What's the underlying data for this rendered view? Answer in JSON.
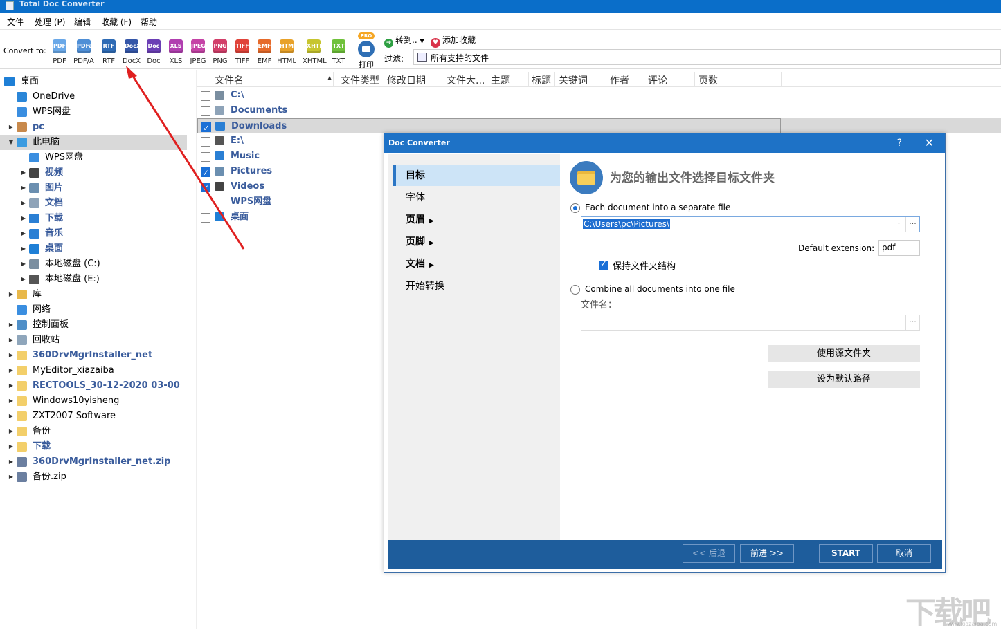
{
  "window": {
    "title": "Total Doc Converter"
  },
  "menu": [
    "文件",
    "处理 (P)",
    "编辑",
    "收藏 (F)",
    "帮助"
  ],
  "toolbar": {
    "convert_label": "Convert to:",
    "formats": [
      {
        "icon": "PDF",
        "label": "PDF",
        "color": "#6aa8e8"
      },
      {
        "icon": "PDFa",
        "label": "PDF/A",
        "color": "#4f8fd6"
      },
      {
        "icon": "RTF",
        "label": "RTF",
        "color": "#2e6bb5"
      },
      {
        "icon": "DocX",
        "label": "DocX",
        "color": "#3456a8"
      },
      {
        "icon": "Doc",
        "label": "Doc",
        "color": "#6b3fb5"
      },
      {
        "icon": "XLS",
        "label": "XLS",
        "color": "#b13fb0"
      },
      {
        "icon": "JPEG",
        "label": "JPEG",
        "color": "#c543a6"
      },
      {
        "icon": "PNG",
        "label": "PNG",
        "color": "#d23f6a"
      },
      {
        "icon": "TIFF",
        "label": "TIFF",
        "color": "#e0443a"
      },
      {
        "icon": "EMF",
        "label": "EMF",
        "color": "#e66a2a"
      },
      {
        "icon": "HTML",
        "label": "HTML",
        "color": "#e8a22a"
      },
      {
        "icon": "XHTML",
        "label": "XHTML",
        "color": "#c7c52f"
      },
      {
        "icon": "TXT",
        "label": "TXT",
        "color": "#6fc13a"
      }
    ],
    "pro_badge": "PRO",
    "print_label": "打印",
    "goto_label": "转到..",
    "fav_label": "添加收藏",
    "filter_label": "过滤:",
    "filter_value": "所有支持的文件"
  },
  "tree": [
    {
      "label": "桌面",
      "level": 0,
      "arrow": "",
      "icon": "#1e7fd6",
      "blue": false
    },
    {
      "label": "OneDrive",
      "level": 1,
      "arrow": "",
      "icon": "#2a86d8",
      "blue": false
    },
    {
      "label": "WPS网盘",
      "level": 1,
      "arrow": "",
      "icon": "#3a8ee0",
      "blue": false
    },
    {
      "label": "pc",
      "level": 1,
      "arrow": "▶",
      "icon": "#c8894b",
      "blue": true
    },
    {
      "label": "此电脑",
      "level": 1,
      "arrow": "▼",
      "icon": "#3b9be0",
      "blue": false,
      "selected": true
    },
    {
      "label": "WPS网盘",
      "level": 2,
      "arrow": "",
      "icon": "#3a8ee0",
      "blue": false
    },
    {
      "label": "视频",
      "level": 2,
      "arrow": "▶",
      "icon": "#444",
      "blue": true
    },
    {
      "label": "图片",
      "level": 2,
      "arrow": "▶",
      "icon": "#6b8fb0",
      "blue": true
    },
    {
      "label": "文档",
      "level": 2,
      "arrow": "▶",
      "icon": "#8ea3b8",
      "blue": true
    },
    {
      "label": "下载",
      "level": 2,
      "arrow": "▶",
      "icon": "#2a7fd4",
      "blue": true
    },
    {
      "label": "音乐",
      "level": 2,
      "arrow": "▶",
      "icon": "#2a7fd4",
      "blue": true
    },
    {
      "label": "桌面",
      "level": 2,
      "arrow": "▶",
      "icon": "#1e7fd6",
      "blue": true
    },
    {
      "label": "本地磁盘 (C:)",
      "level": 2,
      "arrow": "▶",
      "icon": "#7a8ea0",
      "blue": false
    },
    {
      "label": "本地磁盘 (E:)",
      "level": 2,
      "arrow": "▶",
      "icon": "#555",
      "blue": false
    },
    {
      "label": "库",
      "level": 1,
      "arrow": "▶",
      "icon": "#e8b84a",
      "blue": false
    },
    {
      "label": "网络",
      "level": 1,
      "arrow": "",
      "icon": "#3a8ee0",
      "blue": false
    },
    {
      "label": "控制面板",
      "level": 1,
      "arrow": "▶",
      "icon": "#4f8fc8",
      "blue": false
    },
    {
      "label": "回收站",
      "level": 1,
      "arrow": "▶",
      "icon": "#8fa6bb",
      "blue": false
    },
    {
      "label": "360DrvMgrInstaller_net",
      "level": 1,
      "arrow": "▶",
      "icon": "#f3cf6a",
      "blue": true
    },
    {
      "label": "MyEditor_xiazaiba",
      "level": 1,
      "arrow": "▶",
      "icon": "#f3cf6a",
      "blue": false
    },
    {
      "label": "RECTOOLS_30-12-2020 03-00",
      "level": 1,
      "arrow": "▶",
      "icon": "#f3cf6a",
      "blue": true
    },
    {
      "label": "Windows10yisheng",
      "level": 1,
      "arrow": "▶",
      "icon": "#f3cf6a",
      "blue": false
    },
    {
      "label": "ZXT2007 Software",
      "level": 1,
      "arrow": "▶",
      "icon": "#f3cf6a",
      "blue": false
    },
    {
      "label": "备份",
      "level": 1,
      "arrow": "▶",
      "icon": "#f3cf6a",
      "blue": false
    },
    {
      "label": "下载",
      "level": 1,
      "arrow": "▶",
      "icon": "#f3cf6a",
      "blue": true
    },
    {
      "label": "360DrvMgrInstaller_net.zip",
      "level": 1,
      "arrow": "▶",
      "icon": "#6b7fa0",
      "blue": true
    },
    {
      "label": "备份.zip",
      "level": 1,
      "arrow": "▶",
      "icon": "#6b7fa0",
      "blue": false
    }
  ],
  "columns": [
    "文件名",
    "文件类型",
    "修改日期",
    "文件大...",
    "主题",
    "标题",
    "关键词",
    "作者",
    "评论",
    "页数"
  ],
  "files": [
    {
      "name": "C:\\",
      "checked": false,
      "icon": "#7a8ea0"
    },
    {
      "name": "Documents",
      "checked": false,
      "icon": "#8ea3b8"
    },
    {
      "name": "Downloads",
      "checked": true,
      "icon": "#2a7fd4",
      "selected": true
    },
    {
      "name": "E:\\",
      "checked": false,
      "icon": "#555"
    },
    {
      "name": "Music",
      "checked": false,
      "icon": "#2a7fd4"
    },
    {
      "name": "Pictures",
      "checked": true,
      "icon": "#6b8fb0"
    },
    {
      "name": "Videos",
      "checked": true,
      "icon": "#444"
    },
    {
      "name": "WPS网盘",
      "checked": false,
      "icon": ""
    },
    {
      "name": "桌面",
      "checked": false,
      "icon": "#1e7fd6"
    }
  ],
  "dialog": {
    "title": "Doc Converter",
    "help": "?",
    "close": "✕",
    "nav": [
      {
        "label": "目标",
        "selected": true,
        "caret": false
      },
      {
        "label": "字体",
        "selected": false,
        "caret": false
      },
      {
        "label": "页眉",
        "selected": false,
        "caret": true
      },
      {
        "label": "页脚",
        "selected": false,
        "caret": true
      },
      {
        "label": "文档",
        "selected": false,
        "caret": true
      },
      {
        "label": "开始转换",
        "selected": false,
        "caret": false
      }
    ],
    "headline": "为您的输出文件选择目标文件夹",
    "option_separate": "Each document into a separate file",
    "path_value": "C:\\Users\\pc\\Pictures\\",
    "dot_btn": ".",
    "browse_btn": "...",
    "default_ext_label": "Default extension:",
    "default_ext_value": "pdf",
    "keep_structure_label": "保持文件夹结构",
    "option_combine": "Combine all documents into one file",
    "filename_label": "文件名：",
    "use_source_btn": "使用源文件夹",
    "set_default_btn": "设为默认路径",
    "back_btn": "<< 后退",
    "next_btn": "前进 >>",
    "start_btn": "START",
    "cancel_btn": "取消"
  },
  "watermark": {
    "big": "下载吧",
    "small": "www.xiazaiba.com"
  }
}
